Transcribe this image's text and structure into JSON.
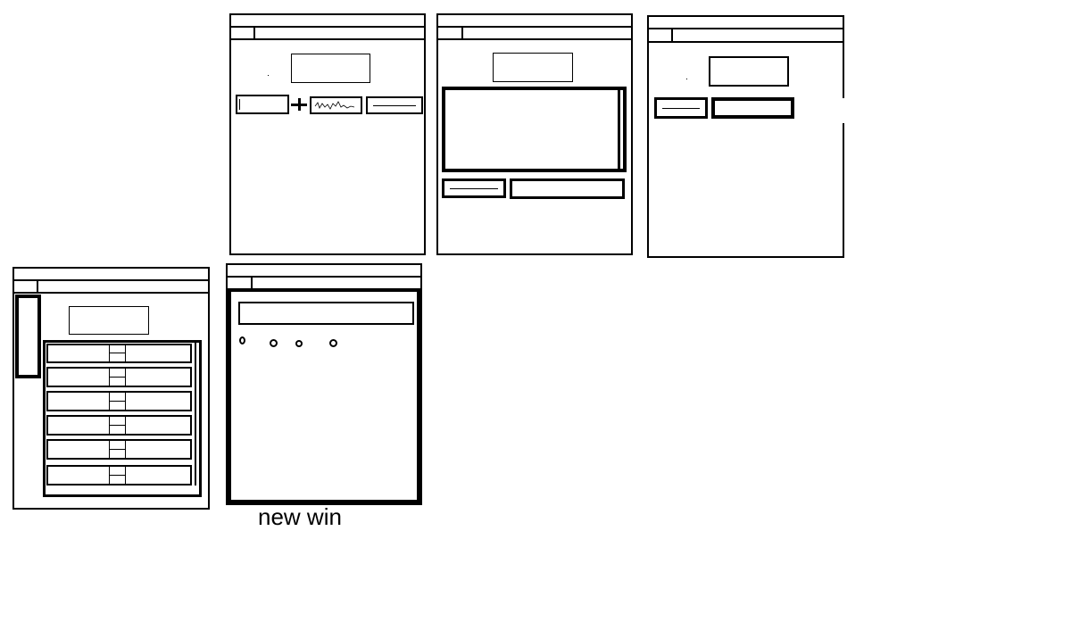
{
  "caption": "new win",
  "colors": {
    "ink": "#000000",
    "paper": "#ffffff"
  }
}
